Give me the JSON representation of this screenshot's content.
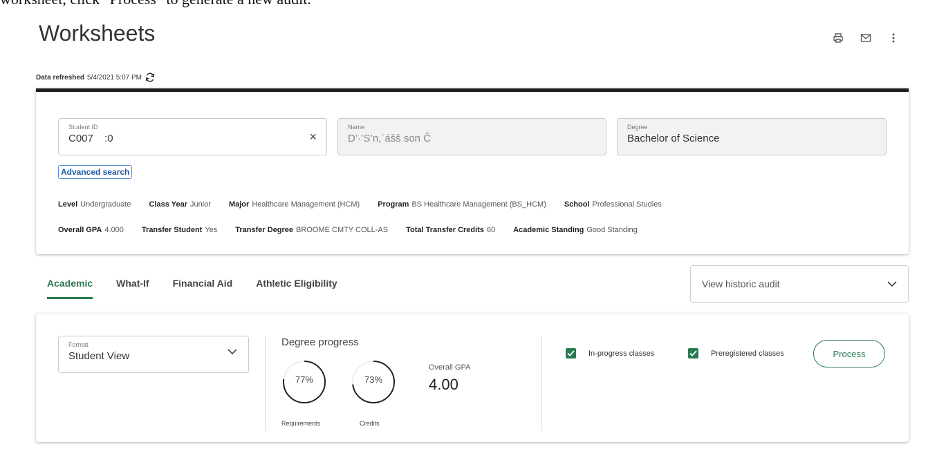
{
  "caption": "worksheet, click \"Process\" to generate a new audit.",
  "page": {
    "title": "Worksheets",
    "refreshed_label": "Data refreshed",
    "refreshed_time": "5/4/2021 5:07 PM"
  },
  "student": {
    "id_label": "Student ID",
    "id_value": "C007     :0",
    "name_label": "Name",
    "name_value": "D’·’S’n,ʿášš son Ĉ",
    "degree_label": "Degree",
    "degree_value": "Bachelor of Science",
    "clear_icon": "×",
    "advanced_search": "Advanced search"
  },
  "info": {
    "level_k": "Level",
    "level_v": "Undergraduate",
    "classyear_k": "Class Year",
    "classyear_v": "Junior",
    "major_k": "Major",
    "major_v": "Healthcare Management (HCM)",
    "program_k": "Program",
    "program_v": "BS Healthcare Management (BS_HCM)",
    "school_k": "School",
    "school_v": "Professional Studies",
    "gpa_k": "Overall GPA",
    "gpa_v": "4.000",
    "transfer_k": "Transfer Student",
    "transfer_v": "Yes",
    "tdegree_k": "Transfer Degree",
    "tdegree_v": "BROOME CMTY COLL-AS",
    "tcredits_k": "Total Transfer Credits",
    "tcredits_v": "60",
    "standing_k": "Academic Standing",
    "standing_v": "Good Standing"
  },
  "tabs": [
    {
      "label": "Academic",
      "active": true
    },
    {
      "label": "What-If"
    },
    {
      "label": "Financial Aid"
    },
    {
      "label": "Athletic Eligibility"
    }
  ],
  "historic": {
    "label": "View historic audit"
  },
  "format": {
    "label": "Format",
    "value": "Student View"
  },
  "progress": {
    "title": "Degree progress",
    "requirements_pct": "77%",
    "requirements_fraction": 0.77,
    "requirements_label": "Requirements",
    "credits_pct": "73%",
    "credits_fraction": 0.73,
    "credits_label": "Credits",
    "gpa_label": "Overall GPA",
    "gpa_value": "4.00"
  },
  "options": {
    "inprogress": "In-progress classes",
    "preregistered": "Preregistered classes",
    "process": "Process"
  },
  "colors": {
    "accent": "#2a7a52",
    "link": "#1a5aa6"
  }
}
